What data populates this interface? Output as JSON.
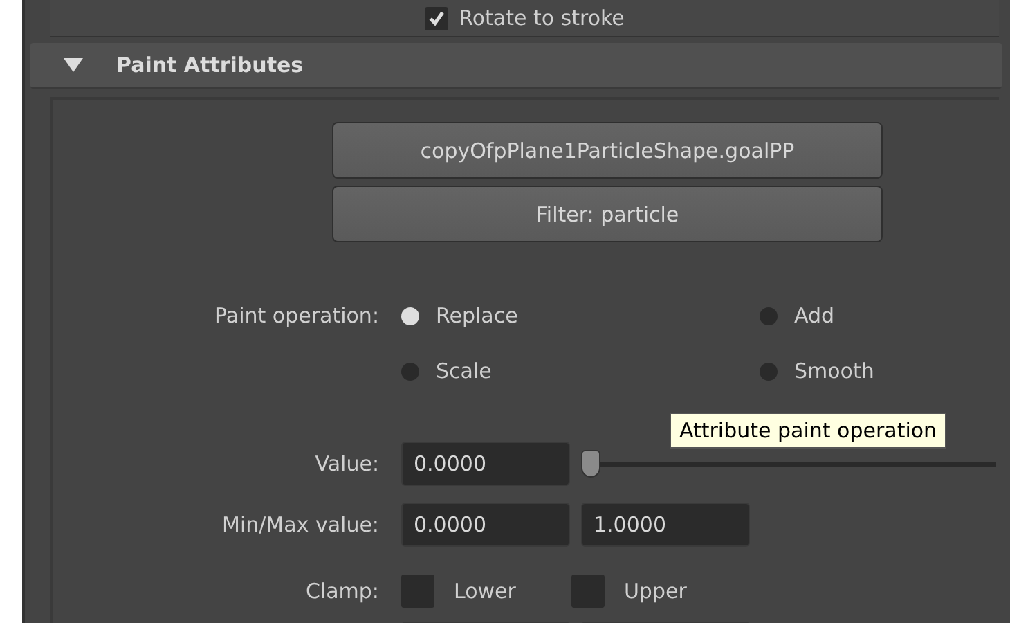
{
  "top_option": {
    "label": "Rotate to stroke",
    "checked": true
  },
  "section": {
    "title": "Paint Attributes",
    "expanded": true
  },
  "attribute_buttons": [
    "copyOfpPlane1ParticleShape.goalPP",
    "Filter: particle"
  ],
  "paint_operation": {
    "label": "Paint operation:",
    "options": [
      {
        "label": "Replace",
        "selected": true
      },
      {
        "label": "Add",
        "selected": false
      },
      {
        "label": "Scale",
        "selected": false
      },
      {
        "label": "Smooth",
        "selected": false
      }
    ]
  },
  "value": {
    "label": "Value:",
    "value": "0.0000",
    "level": 0
  },
  "minmax": {
    "label": "Min/Max value:",
    "min": "0.0000",
    "max": "1.0000"
  },
  "clamp": {
    "label": "Clamp:",
    "options": [
      {
        "label": "Lower",
        "checked": false
      },
      {
        "label": "Upper",
        "checked": false
      }
    ]
  },
  "tooltip": "Attribute paint operation"
}
